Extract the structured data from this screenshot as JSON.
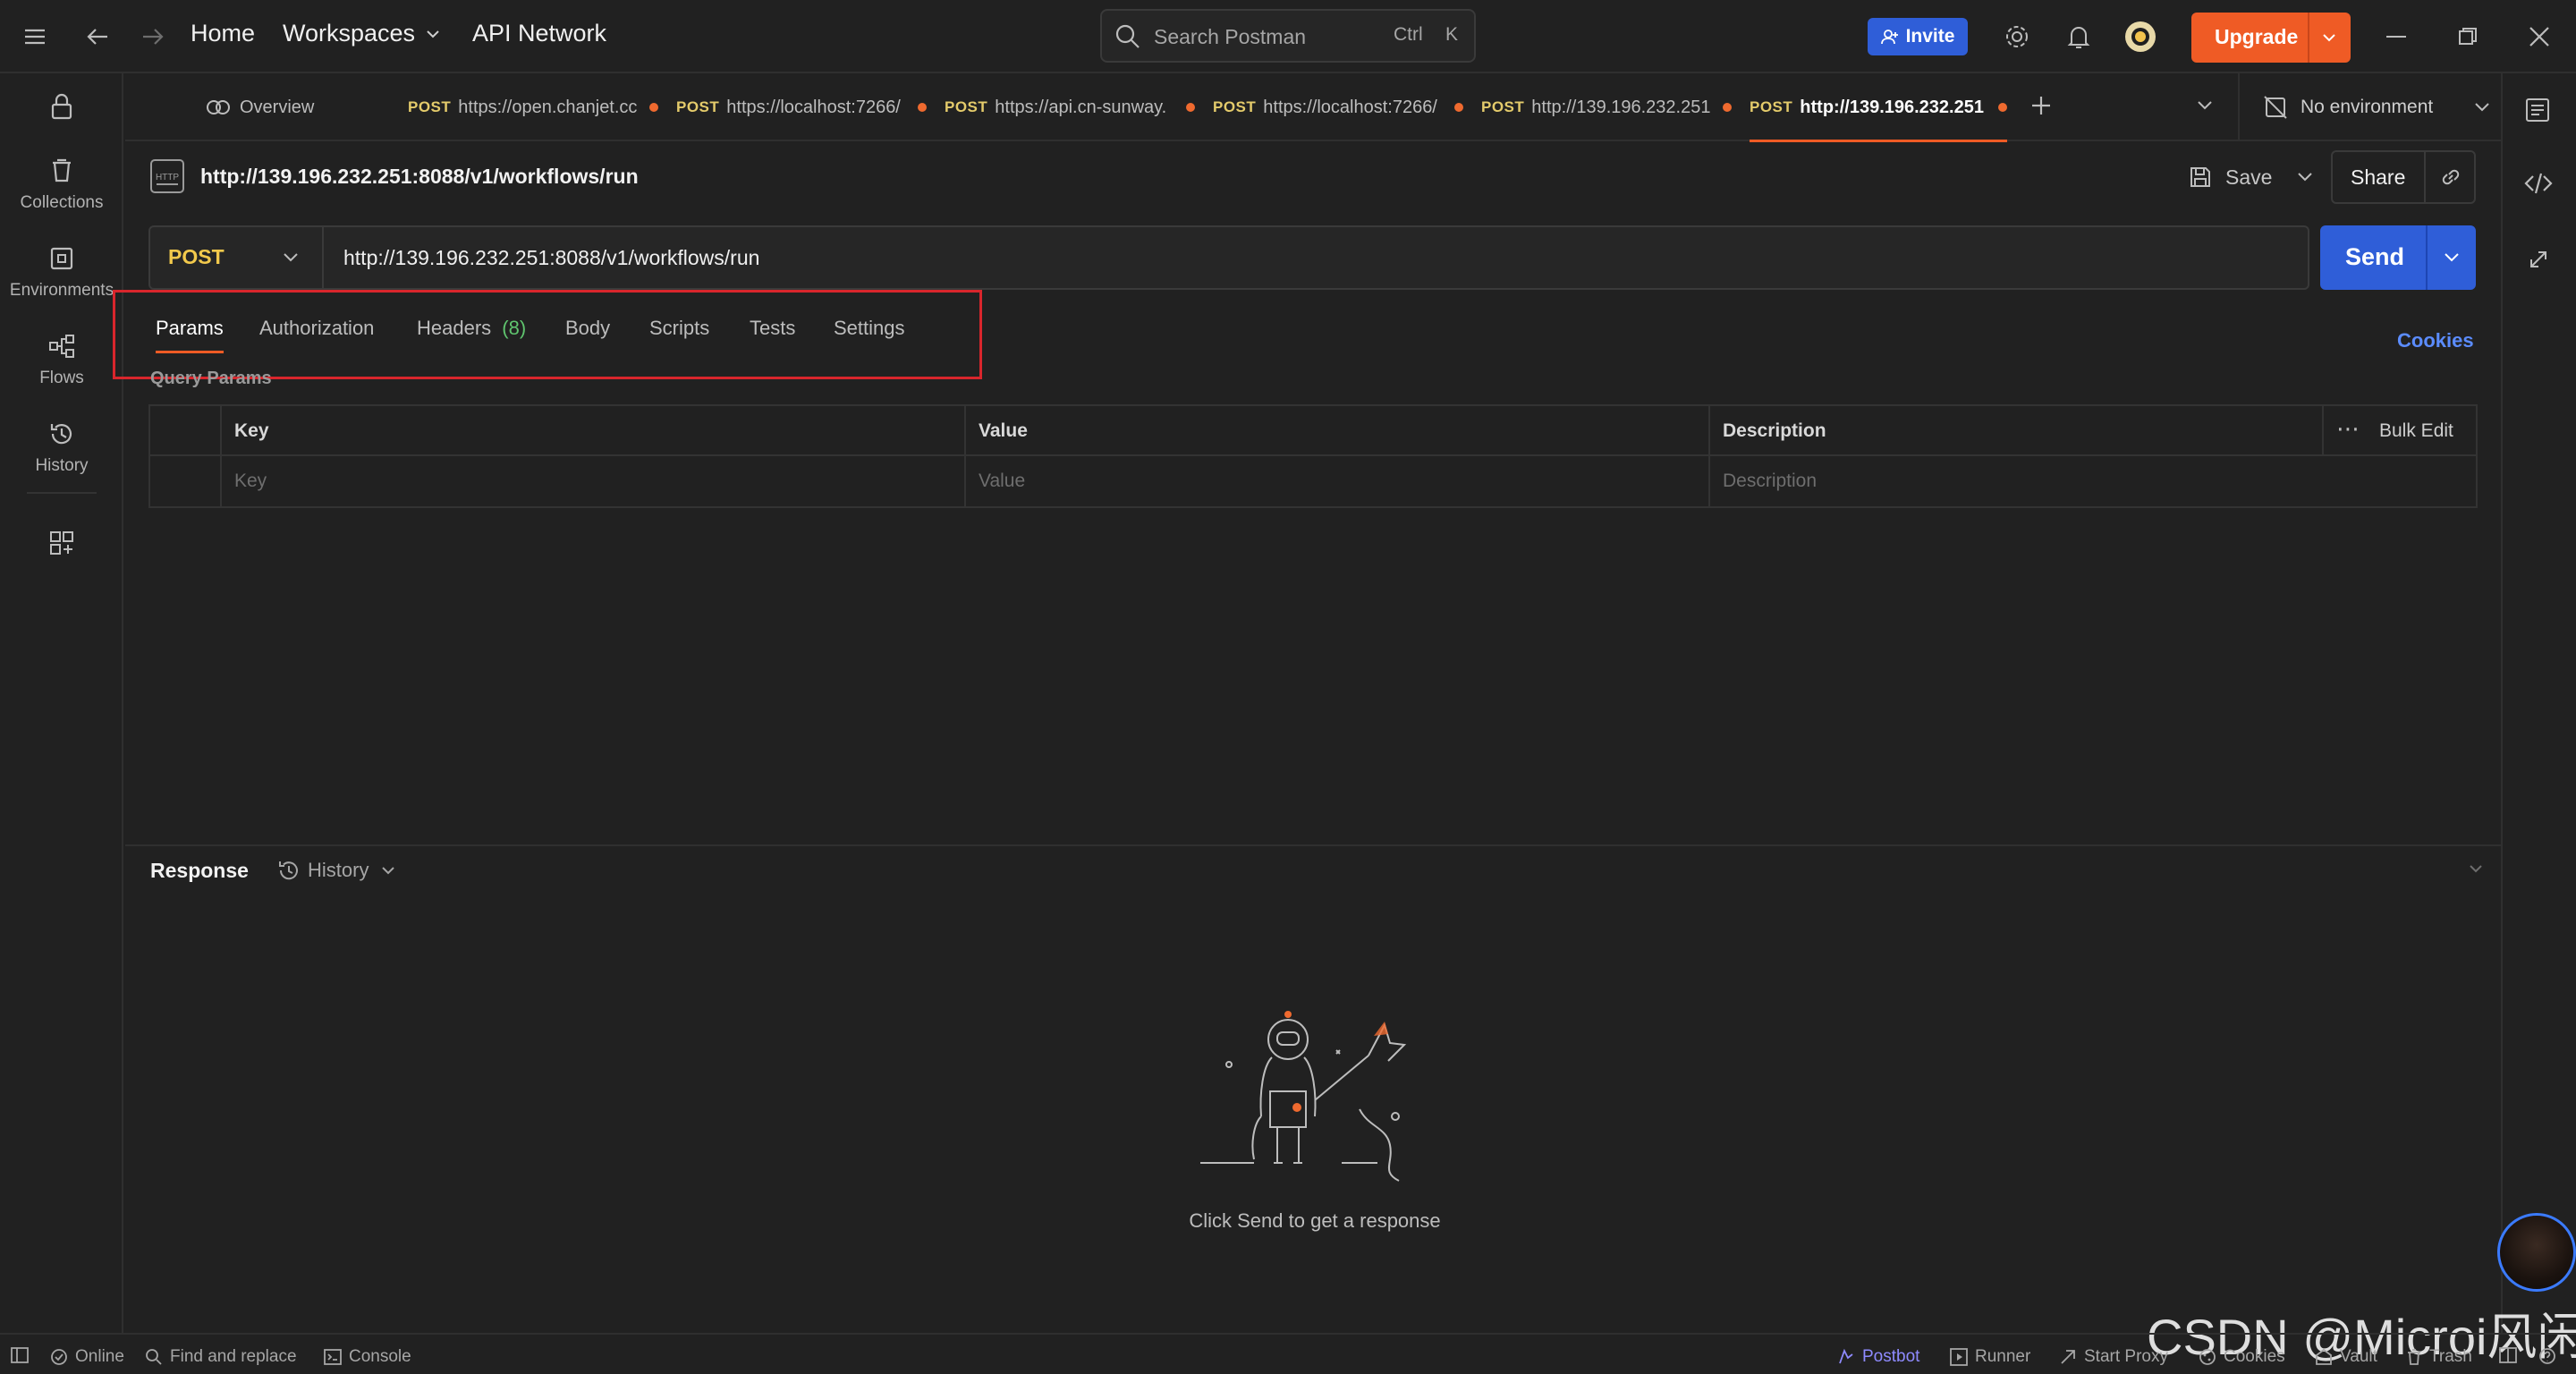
{
  "topbar": {
    "home": "Home",
    "workspaces": "Workspaces",
    "api_network": "API Network",
    "search_placeholder": "Search Postman",
    "shortcut_ctrl": "Ctrl",
    "shortcut_k": "K",
    "invite": "Invite",
    "upgrade": "Upgrade"
  },
  "sidebar": {
    "items": [
      {
        "label": "Collections",
        "icon": "trash-can-icon"
      },
      {
        "label": "Environments",
        "icon": "environment-icon"
      },
      {
        "label": "Flows",
        "icon": "flows-icon"
      },
      {
        "label": "History",
        "icon": "history-icon"
      }
    ]
  },
  "tabs": {
    "overview": "Overview",
    "items": [
      {
        "method": "POST",
        "url": "https://open.chanjet.cc"
      },
      {
        "method": "POST",
        "url": "https://localhost:7266/"
      },
      {
        "method": "POST",
        "url": "https://api.cn-sunway."
      },
      {
        "method": "POST",
        "url": "https://localhost:7266/"
      },
      {
        "method": "POST",
        "url": "http://139.196.232.251"
      },
      {
        "method": "POST",
        "url": "http://139.196.232.251"
      }
    ],
    "environment": "No environment"
  },
  "request": {
    "title": "http://139.196.232.251:8088/v1/workflows/run",
    "save": "Save",
    "share": "Share",
    "method": "POST",
    "url": "http://139.196.232.251:8088/v1/workflows/run",
    "send": "Send"
  },
  "subtabs": {
    "params": "Params",
    "authorization": "Authorization",
    "headers": "Headers",
    "headers_count": "(8)",
    "body": "Body",
    "scripts": "Scripts",
    "tests": "Tests",
    "settings": "Settings",
    "cookies": "Cookies"
  },
  "query_params": {
    "title": "Query Params",
    "headers": {
      "key": "Key",
      "value": "Value",
      "description": "Description",
      "bulk_edit": "Bulk Edit"
    },
    "placeholders": {
      "key": "Key",
      "value": "Value",
      "description": "Description"
    }
  },
  "response": {
    "label": "Response",
    "history": "History",
    "empty": "Click Send to get a response"
  },
  "statusbar": {
    "online": "Online",
    "find_replace": "Find and replace",
    "console": "Console",
    "postbot": "Postbot",
    "runner": "Runner",
    "start_proxy": "Start Proxy",
    "cookies": "Cookies",
    "vault": "Vault",
    "trash": "Trash"
  },
  "watermark": "CSDN @Microi风闲",
  "colors": {
    "accent": "#ef5b25",
    "primary": "#2f5ed8",
    "method_post": "#e4cb6b",
    "highlight_box": "#d9262c"
  }
}
